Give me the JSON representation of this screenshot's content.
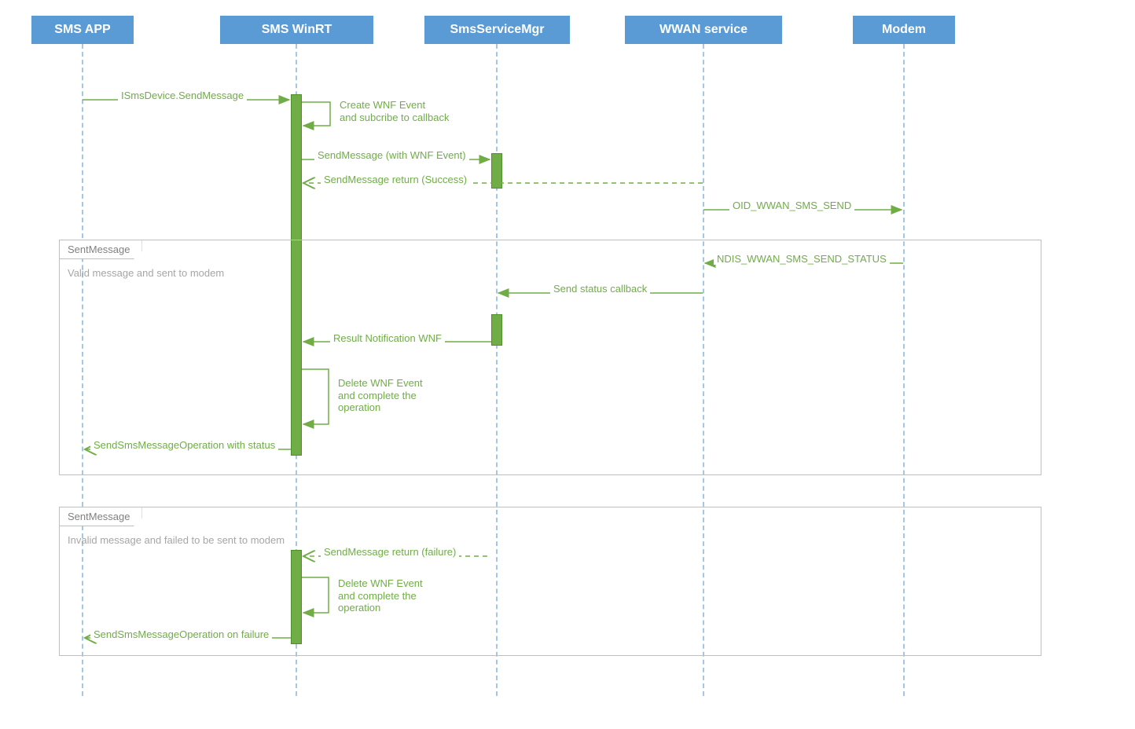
{
  "participants": {
    "p0": "SMS APP",
    "p1": "SMS WinRT",
    "p2": "SmsServiceMgr",
    "p3": "WWAN service",
    "p4": "Modem"
  },
  "messages": {
    "m1": "ISmsDevice.SendMessage",
    "m2": "Create WNF Event\nand subcribe to callback",
    "m3": "SendMessage (with WNF Event)",
    "m4": "SendMessage return (Success)",
    "m5": "OID_WWAN_SMS_SEND",
    "m6": "NDIS_WWAN_SMS_SEND_STATUS",
    "m7": "Send status callback",
    "m8": "Result Notification WNF",
    "m9": "Delete WNF Event\nand complete the\noperation",
    "m10": "SendSmsMessageOperation with status",
    "m11": "SendMessage return (failure)",
    "m12": "Delete WNF Event\nand complete the\noperation",
    "m13": "SendSmsMessageOperation on failure"
  },
  "frames": {
    "f1_title": "SentMessage",
    "f1_desc": "Valid message and sent to modem",
    "f2_title": "SentMessage",
    "f2_desc": "Invalid message and failed to be sent to modem"
  },
  "colors": {
    "participant_bg": "#5b9bd5",
    "message": "#70ad47",
    "frame_border": "#bfbfbf"
  }
}
